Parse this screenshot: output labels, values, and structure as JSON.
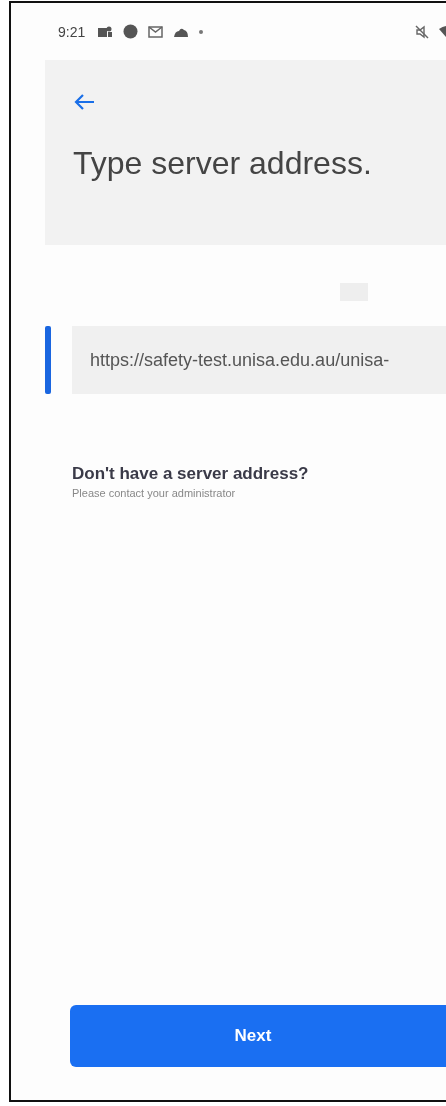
{
  "status_bar": {
    "time": "9:21"
  },
  "header": {
    "title": "Type server address."
  },
  "server_field": {
    "value": "https://safety-test.unisa.edu.au/unisa-",
    "focused": true
  },
  "help": {
    "title": "Don't have a server address?",
    "subtitle": "Please contact your administrator"
  },
  "next_button": {
    "label": "Next",
    "disabled": false
  }
}
